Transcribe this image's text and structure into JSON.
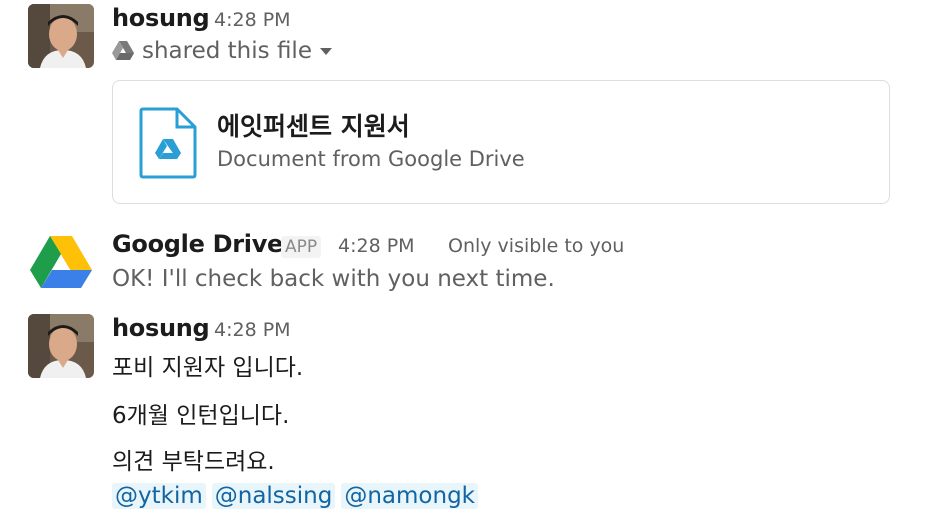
{
  "messages": [
    {
      "author": "hosung",
      "time": "4:28 PM",
      "action": "shared this file",
      "file": {
        "title": "에잇퍼센트 지원서",
        "subtitle": "Document from Google Drive",
        "icon": "google-drive-doc-icon"
      }
    },
    {
      "author": "Google Drive",
      "badge": "APP",
      "time": "4:28 PM",
      "visibility": "Only visible to you",
      "text": "OK! I'll check back with you next time."
    },
    {
      "author": "hosung",
      "time": "4:28 PM",
      "lines": [
        "포비 지원자 입니다.",
        "6개월 인턴입니다.",
        "의견 부탁드려요."
      ],
      "mentions": [
        "@ytkim",
        "@nalssing",
        "@namongk"
      ]
    }
  ],
  "colors": {
    "mention": "#1264a3",
    "mention_bg": "#e8f5fa",
    "drive_blue": "#2a9fd6"
  }
}
